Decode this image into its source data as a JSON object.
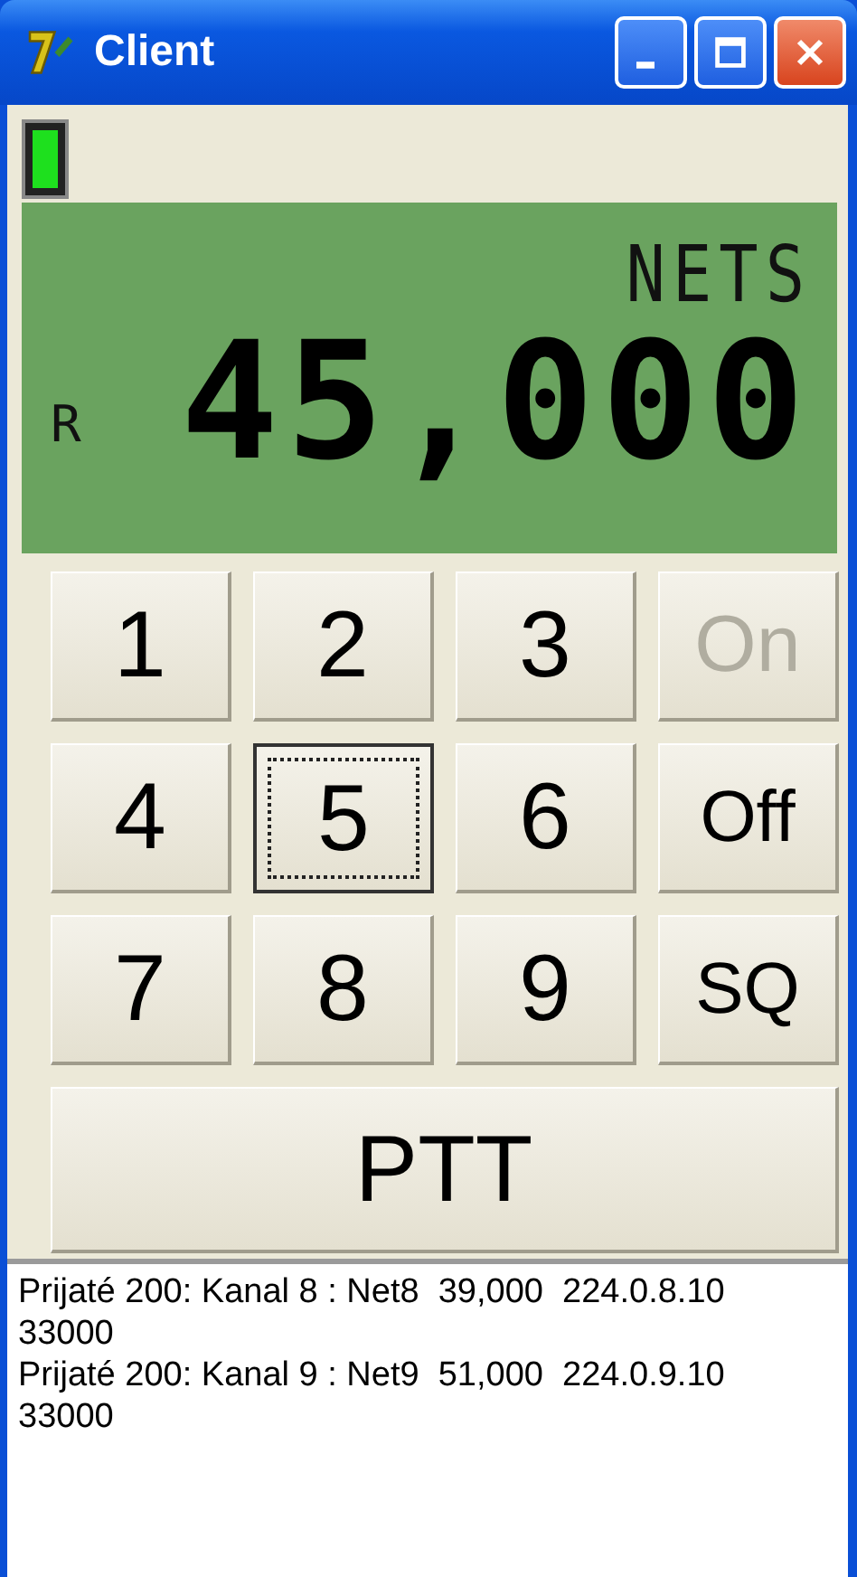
{
  "window": {
    "title": "Client"
  },
  "status_led": {
    "on": true
  },
  "display": {
    "mode": "NETS",
    "indicator": "R",
    "frequency": "45,000"
  },
  "keypad": [
    {
      "label": "1",
      "kind": "key",
      "disabled": false,
      "focused": false
    },
    {
      "label": "2",
      "kind": "key",
      "disabled": false,
      "focused": false
    },
    {
      "label": "3",
      "kind": "key",
      "disabled": false,
      "focused": false
    },
    {
      "label": "On",
      "kind": "key",
      "disabled": true,
      "focused": false
    },
    {
      "label": "4",
      "kind": "key",
      "disabled": false,
      "focused": false
    },
    {
      "label": "5",
      "kind": "key",
      "disabled": false,
      "focused": true
    },
    {
      "label": "6",
      "kind": "key",
      "disabled": false,
      "focused": false
    },
    {
      "label": "Off",
      "kind": "key",
      "disabled": false,
      "focused": false
    },
    {
      "label": "7",
      "kind": "key",
      "disabled": false,
      "focused": false
    },
    {
      "label": "8",
      "kind": "key",
      "disabled": false,
      "focused": false
    },
    {
      "label": "9",
      "kind": "key",
      "disabled": false,
      "focused": false
    },
    {
      "label": "SQ",
      "kind": "key",
      "disabled": false,
      "focused": false
    },
    {
      "label": "PTT",
      "kind": "wide",
      "disabled": false,
      "focused": false
    }
  ],
  "log": {
    "lines": [
      "Prijaté 200: Kanal 8 : Net8  39,000  224.0.8.10",
      "33000",
      "Prijaté 200: Kanal 9 : Net9  51,000  224.0.9.10",
      "33000"
    ]
  }
}
